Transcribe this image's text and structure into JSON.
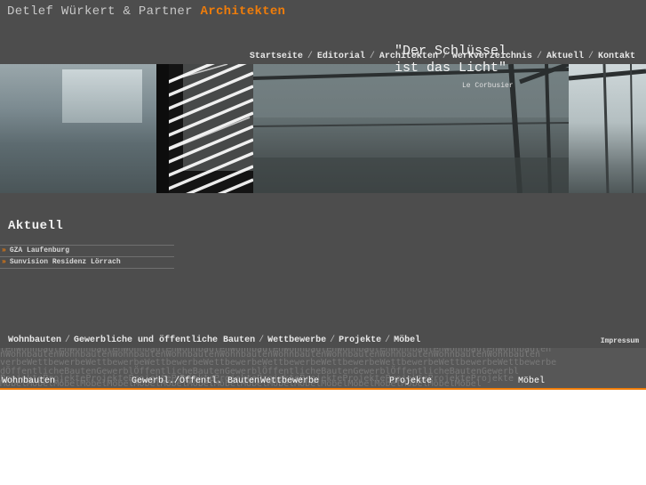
{
  "header": {
    "brand_name": "Detlef Würkert & Partner",
    "brand_accent": "Architekten",
    "nav": [
      "Startseite",
      "Editorial",
      "Architekten",
      "Werkverzeichnis",
      "Aktuell",
      "Kontakt"
    ],
    "nav_separator": "/"
  },
  "banner": {
    "quote_line1": "\"Der Schlüssel",
    "quote_line2": "ist das Licht\"",
    "quote_author": "Le Corbusier"
  },
  "aktuell": {
    "title": "Aktuell",
    "items": [
      {
        "arrow": "»",
        "label": "GZA Laufenburg"
      },
      {
        "arrow": "»",
        "label": "Sunvision Residenz Lörrach"
      }
    ]
  },
  "categories": {
    "links": [
      "Wohnbauten",
      "Gewerbliche und öffentliche Bauten",
      "Wettbewerbe",
      "Projekte",
      "Möbel"
    ],
    "separator": "/",
    "impressum": "Impressum"
  },
  "strip": {
    "bg_rows": [
      "tenWohnbautenWohnbautenWohnbautenWohnbautenWohnbautenWohnbautenWohnbautenWohnbautenWohnbautenWohnbauten",
      "nWohnbautenWohnbautenWohnbautenWohnbautenWohnbautenWohnbautenWohnbautenWohnbautenWohnbautenWohnbauten",
      "verbeWettbewerbeWettbewerbeWettbewerbeWettbewerbeWettbewerbeWettbewerbeWettbewerbeWettbewerbeWettbewerbe",
      "dÖffentlicheBautenGewerblÖffentlicheBautenGewerblÖffentlicheBautenGewerblÖffentlicheBautenGewerbl",
      "ProjekteProjekteProjekteProjekteProjekteProjekteProjekteProjekteProjekteProjekteProjekteProjekte",
      "MöbelMöbelMöbelMöbelMöbelMöbelMöbelMöbelMöbelMöbelMöbelMöbelMöbelMöbelMöbelMöbelMöbelMöbel"
    ],
    "columns": [
      "Wohnbauten",
      "Gewerbl./Öffentl. Bauten",
      "Wettbewerbe",
      "Projekte",
      "Möbel"
    ]
  },
  "colors": {
    "accent": "#f07d0a",
    "panel": "#4d4d4d",
    "text_light": "#e8e8e8"
  }
}
